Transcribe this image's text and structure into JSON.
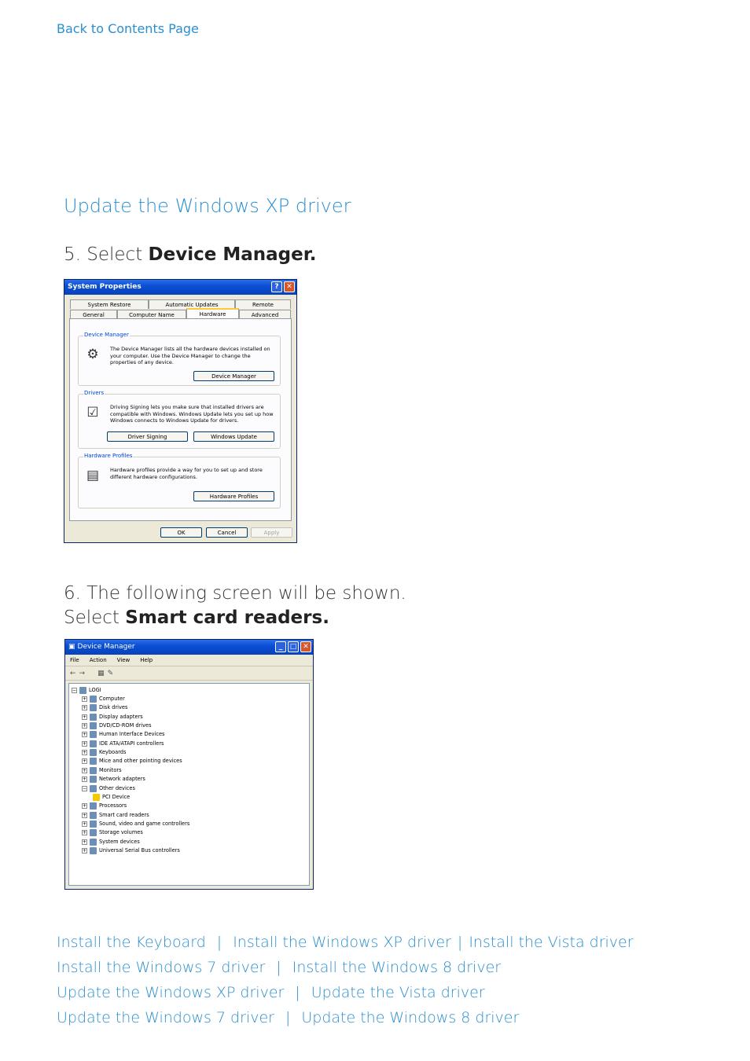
{
  "back_link": "Back to Contents Page",
  "section_title": "Update the Windows XP driver",
  "step5": {
    "prefix": "5. Select ",
    "bold": "Device Manager."
  },
  "step6": {
    "line1": "6. The following screen will be shown.",
    "prefix": "Select ",
    "bold": "Smart card readers."
  },
  "system_properties": {
    "title": "System Properties",
    "help_glyph": "?",
    "close_glyph": "✕",
    "tabs_back": [
      "System Restore",
      "Automatic Updates",
      "Remote"
    ],
    "tabs_front": [
      "General",
      "Computer Name",
      "Hardware",
      "Advanced"
    ],
    "active_tab": "Hardware",
    "device_manager": {
      "label": "Device Manager",
      "text": "The Device Manager lists all the hardware devices installed on your computer. Use the Device Manager to change the properties of any device.",
      "button": "Device Manager"
    },
    "drivers": {
      "label": "Drivers",
      "text": "Driving Signing lets you make sure that installed drivers are compatible with Windows. Windows Update lets you set up how Windows connects to Windows Update for drivers.",
      "button_signing": "Driver Signing",
      "button_update": "Windows Update"
    },
    "hardware_profiles": {
      "label": "Hardware Profiles",
      "text": "Hardware profiles provide a way for you to set up and store different hardware configurations.",
      "button": "Hardware Profiles"
    },
    "ok": "OK",
    "cancel": "Cancel",
    "apply": "Apply"
  },
  "device_manager_window": {
    "title": "Device Manager",
    "menu": [
      "File",
      "Action",
      "View",
      "Help"
    ],
    "toolbar": [
      "←",
      "→",
      "▦",
      "✎"
    ],
    "root": "LOGI",
    "nodes": [
      {
        "label": "Computer",
        "exp": "+"
      },
      {
        "label": "Disk drives",
        "exp": "+"
      },
      {
        "label": "Display adapters",
        "exp": "+"
      },
      {
        "label": "DVD/CD-ROM drives",
        "exp": "+"
      },
      {
        "label": "Human Interface Devices",
        "exp": "+"
      },
      {
        "label": "IDE ATA/ATAPI controllers",
        "exp": "+"
      },
      {
        "label": "Keyboards",
        "exp": "+"
      },
      {
        "label": "Mice and other pointing devices",
        "exp": "+"
      },
      {
        "label": "Monitors",
        "exp": "+"
      },
      {
        "label": "Network adapters",
        "exp": "+"
      },
      {
        "label": "Other devices",
        "exp": "−"
      },
      {
        "label": "PCI Device",
        "exp": "",
        "child": true
      },
      {
        "label": "Processors",
        "exp": "+"
      },
      {
        "label": "Smart card readers",
        "exp": "+"
      },
      {
        "label": "Sound, video and game controllers",
        "exp": "+"
      },
      {
        "label": "Storage volumes",
        "exp": "+"
      },
      {
        "label": "System devices",
        "exp": "+"
      },
      {
        "label": "Universal Serial Bus controllers",
        "exp": "+"
      }
    ]
  },
  "nav": {
    "separator": "|",
    "install_keyboard": "Install the Keyboard",
    "install_xp": "Install the Windows XP driver",
    "install_vista": "Install the Vista driver",
    "install_win7": "Install the Windows 7 driver",
    "install_win8": "Install the Windows 8 driver",
    "update_xp": "Update the Windows XP driver",
    "update_vista": "Update the Vista driver",
    "update_win7": "Update the Windows 7 driver",
    "update_win8": "Update the Windows 8 driver"
  }
}
